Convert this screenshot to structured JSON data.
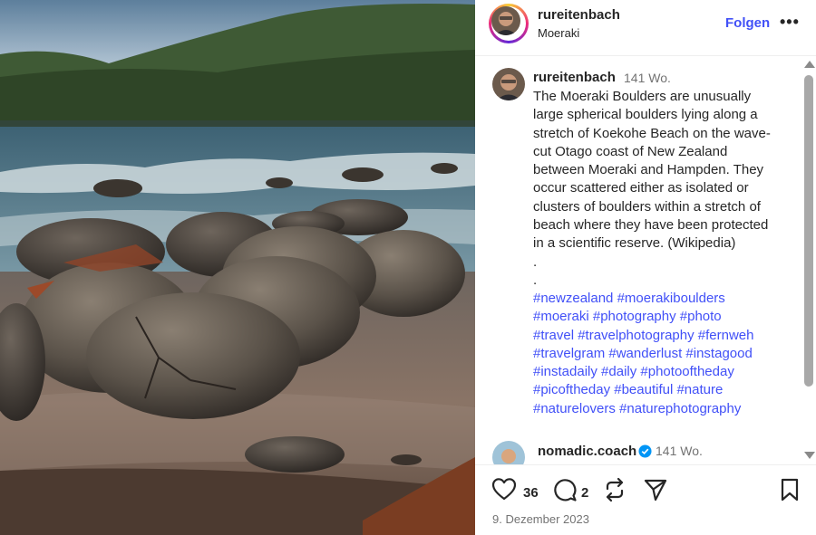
{
  "post": {
    "username": "rureitenbach",
    "location": "Moeraki",
    "follow_label": "Folgen",
    "more_label": "•••"
  },
  "caption": {
    "username": "rureitenbach",
    "time": "141 Wo.",
    "lines": [
      "The Moeraki Boulders are unusually",
      "large spherical boulders lying along a",
      "stretch of Koekohe Beach on the wave-",
      "cut Otago coast of New Zealand",
      "between Moeraki and Hampden. They",
      "occur scattered either as isolated or",
      "clusters of boulders within a stretch of",
      "beach where they have been protected",
      "in a scientific reserve. (Wikipedia)",
      ".",
      "."
    ],
    "hashtag_lines": [
      "#newzealand #moerakiboulders",
      "#moeraki #photography #photo",
      "#travel #travelphotography #fernweh",
      "#travelgram #wanderlust #instagood",
      "#instadaily #daily #photooftheday",
      "#picoftheday #beautiful #nature",
      "#naturelovers #naturephotography"
    ]
  },
  "comment": {
    "username": "nomadic.coach",
    "time": "141 Wo."
  },
  "actions": {
    "likes": "36",
    "comments": "2",
    "date": "9. Dezember 2023"
  },
  "icons": {
    "like": "heart-icon",
    "comment": "comment-bubble-icon",
    "share": "repost-icon",
    "send": "send-icon",
    "save": "bookmark-icon",
    "verified": "verified-badge-icon"
  },
  "colors": {
    "accent": "#4150f7",
    "text": "#262626",
    "muted": "#737373"
  }
}
